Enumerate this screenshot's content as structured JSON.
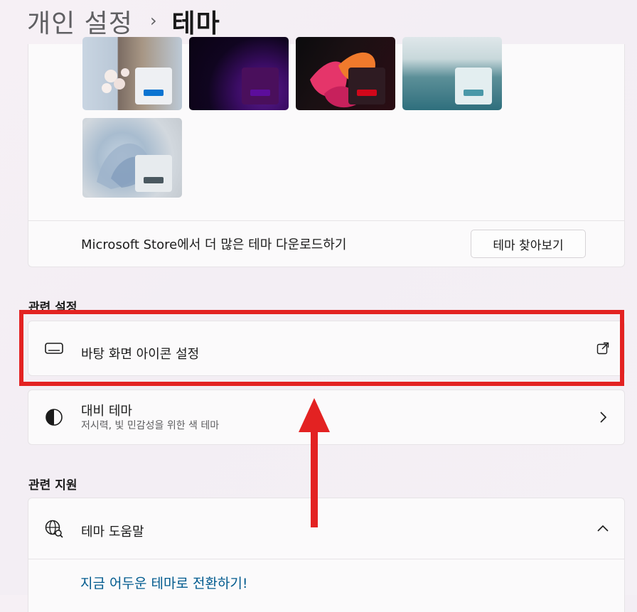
{
  "breadcrumb": {
    "parent": "개인 설정",
    "separator": "›",
    "current": "테마"
  },
  "themes": {
    "tiles": [
      {
        "name": "bloom-sky-theme",
        "accent": "#0a74d1"
      },
      {
        "name": "glow-purple-theme",
        "accent": "#5c0d9c"
      },
      {
        "name": "captured-motion-theme",
        "accent": "#d1071a"
      },
      {
        "name": "lake-theme",
        "accent": "#4a98a8"
      },
      {
        "name": "flow-theme",
        "accent": "#4a5860"
      }
    ],
    "store_text": "Microsoft Store에서 더 많은 테마 다운로드하기",
    "browse_button": "테마 찾아보기"
  },
  "related_settings": {
    "title": "관련 설정",
    "desktop_icons": {
      "label": "바탕 화면 아이콘 설정",
      "icon": "monitor-icon",
      "right_icon": "open-external-icon"
    },
    "contrast": {
      "label": "대비 테마",
      "sublabel": "저시력, 빛 민감성을 위한 색 테마",
      "icon": "contrast-icon",
      "right_icon": "chevron-right-icon"
    }
  },
  "related_support": {
    "title": "관련 지원",
    "help": {
      "label": "테마 도움말",
      "icon": "globe-search-icon",
      "right_icon": "chevron-up-icon"
    },
    "link": "지금 어두운 테마로 전환하기!"
  },
  "annotation": {
    "highlight_color": "#e32222"
  }
}
